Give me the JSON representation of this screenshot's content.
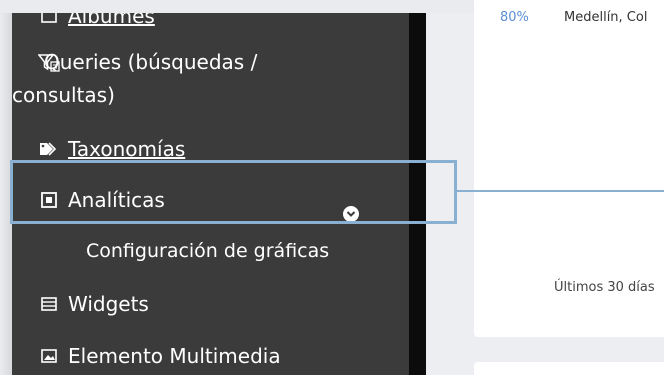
{
  "sidebar": {
    "items": [
      {
        "label": "Álbumes",
        "icon": "folder-icon"
      },
      {
        "label": "Queries (búsquedas / consultas)",
        "icon": "filter-icon"
      },
      {
        "label": "Taxonomías",
        "icon": "tags-icon"
      },
      {
        "label": "Analíticas",
        "icon": "square-icon",
        "expanded": true
      },
      {
        "label": "Widgets",
        "icon": "bars-icon"
      },
      {
        "label": "Elemento Multimedia",
        "icon": "image-icon"
      }
    ],
    "subitems": [
      {
        "label": "Configuración de gráficas"
      }
    ]
  },
  "card": {
    "percent": "80%",
    "location": "Medellín, Col",
    "footer": "Últimos 30 días"
  },
  "colors": {
    "sidebar_bg": "#3b3b3b",
    "highlight": "#8ab0d1",
    "percent": "#5b8fd6"
  }
}
